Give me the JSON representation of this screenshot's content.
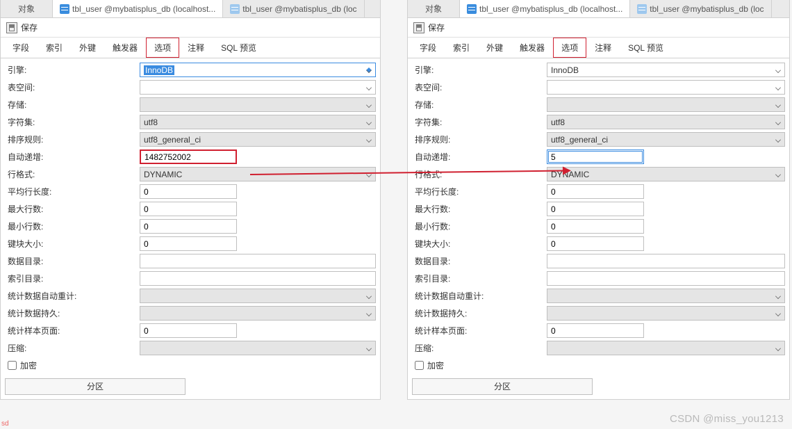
{
  "watermark": "CSDN @miss_you1213",
  "smallmark": "sd",
  "toptabs": {
    "objects": "对象",
    "active": "tbl_user @mybatisplus_db (localhost...",
    "inactive": "tbl_user @mybatisplus_db (loc"
  },
  "toolbar": {
    "save": "保存"
  },
  "subtabs": {
    "fields": "字段",
    "indexes": "索引",
    "fk": "外键",
    "triggers": "触发器",
    "options": "选项",
    "comments": "注释",
    "sql": "SQL 预览"
  },
  "labels": {
    "engine": "引擎:",
    "tablespace": "表空间:",
    "storage": "存储:",
    "charset": "字符集:",
    "collation": "排序规则:",
    "autoinc": "自动递增:",
    "rowformat": "行格式:",
    "avgrowlen": "平均行长度:",
    "maxrows": "最大行数:",
    "minrows": "最小行数:",
    "keyblock": "键块大小:",
    "datadir": "数据目录:",
    "indexdir": "索引目录:",
    "statsauto": "统计数据自动重计:",
    "statspersist": "统计数据持久:",
    "statssample": "统计样本页面:",
    "compress": "压缩:",
    "encrypt": "加密",
    "partition": "分区"
  },
  "left": {
    "engine": "InnoDB",
    "tablespace": "",
    "storage": "",
    "charset": "utf8",
    "collation": "utf8_general_ci",
    "autoinc": "1482752002",
    "rowformat": "DYNAMIC",
    "avgrowlen": "0",
    "maxrows": "0",
    "minrows": "0",
    "keyblock": "0",
    "datadir": "",
    "indexdir": "",
    "statsauto": "",
    "statspersist": "",
    "statssample": "0",
    "compress": ""
  },
  "right": {
    "engine": "InnoDB",
    "tablespace": "",
    "storage": "",
    "charset": "utf8",
    "collation": "utf8_general_ci",
    "autoinc": "5",
    "rowformat": "DYNAMIC",
    "avgrowlen": "0",
    "maxrows": "0",
    "minrows": "0",
    "keyblock": "0",
    "datadir": "",
    "indexdir": "",
    "statsauto": "",
    "statspersist": "",
    "statssample": "0",
    "compress": ""
  }
}
